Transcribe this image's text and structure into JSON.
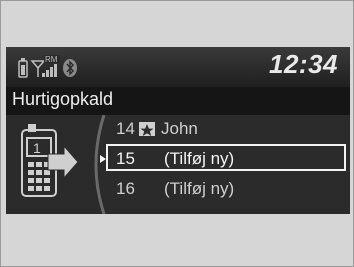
{
  "status": {
    "clock": "12:34",
    "icons": [
      "phone-battery-icon",
      "signal-strength-icon",
      "roaming-indicator-icon",
      "bluetooth-icon"
    ],
    "roaming_label": "RM"
  },
  "header": {
    "title": "Hurtigopkald"
  },
  "list": {
    "items": [
      {
        "number": "14",
        "name": "John",
        "has_star": true
      },
      {
        "number": "15",
        "name": "(Tilføj ny)",
        "selected": true
      },
      {
        "number": "16",
        "name": "(Tilføj ny)"
      }
    ],
    "phone_badge": "1"
  },
  "colors": {
    "background": "#d6d6d6",
    "screen": "#2a2a2a",
    "text": "#e9e9e9"
  }
}
